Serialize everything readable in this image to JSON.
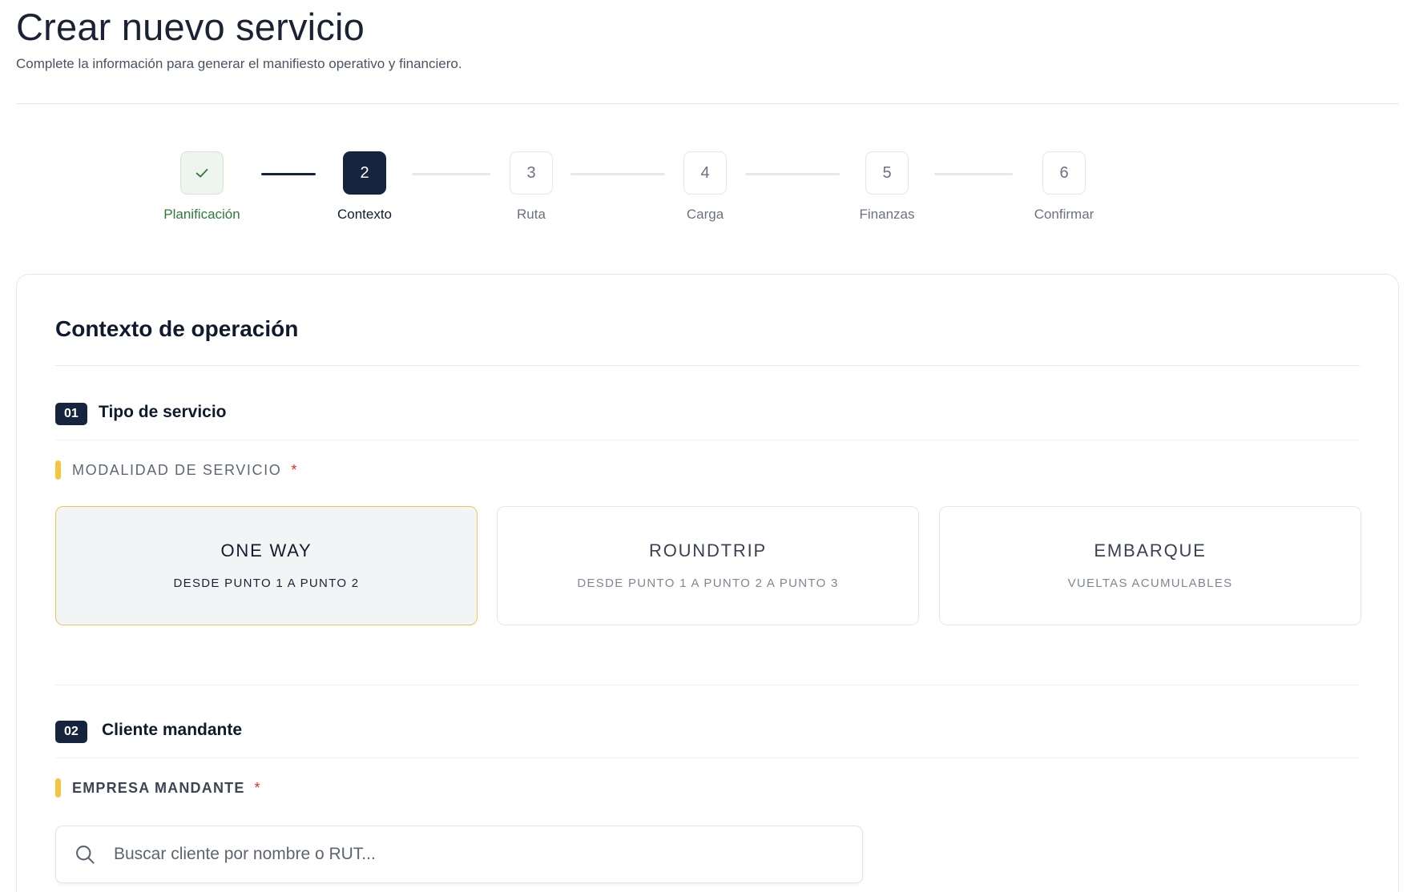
{
  "header": {
    "title": "Crear nuevo servicio",
    "subtitle": "Complete la información para generar el manifiesto operativo y financiero."
  },
  "stepper": {
    "steps": [
      {
        "number": "✓",
        "label": "Planificación",
        "state": "done"
      },
      {
        "number": "2",
        "label": "Contexto",
        "state": "active"
      },
      {
        "number": "3",
        "label": "Ruta",
        "state": "pending"
      },
      {
        "number": "4",
        "label": "Carga",
        "state": "pending"
      },
      {
        "number": "5",
        "label": "Finanzas",
        "state": "pending"
      },
      {
        "number": "6",
        "label": "Confirmar",
        "state": "pending"
      }
    ]
  },
  "card": {
    "title": "Contexto de operación",
    "section1": {
      "number": "01",
      "title": "Tipo de servicio",
      "field_label": "MODALIDAD DE SERVICIO",
      "required_mark": "*",
      "options": [
        {
          "title": "ONE WAY",
          "subtitle": "DESDE PUNTO 1 A PUNTO 2",
          "selected": true
        },
        {
          "title": "ROUNDTRIP",
          "subtitle": "DESDE PUNTO 1 A PUNTO 2 A PUNTO 3",
          "selected": false
        },
        {
          "title": "EMBARQUE",
          "subtitle": "VUELTAS ACUMULABLES",
          "selected": false
        }
      ]
    },
    "section2": {
      "number": "02",
      "title": "Cliente mandante",
      "field_label": "EMPRESA MANDANTE",
      "required_mark": "*",
      "search": {
        "placeholder": "Buscar cliente por nombre o RUT...",
        "value": "",
        "icon": "search-icon"
      }
    }
  },
  "colors": {
    "primary_dark": "#17243d",
    "done_green": "#2e7a39",
    "accent_yellow": "#f5c542",
    "required_red": "#d12d2d"
  }
}
